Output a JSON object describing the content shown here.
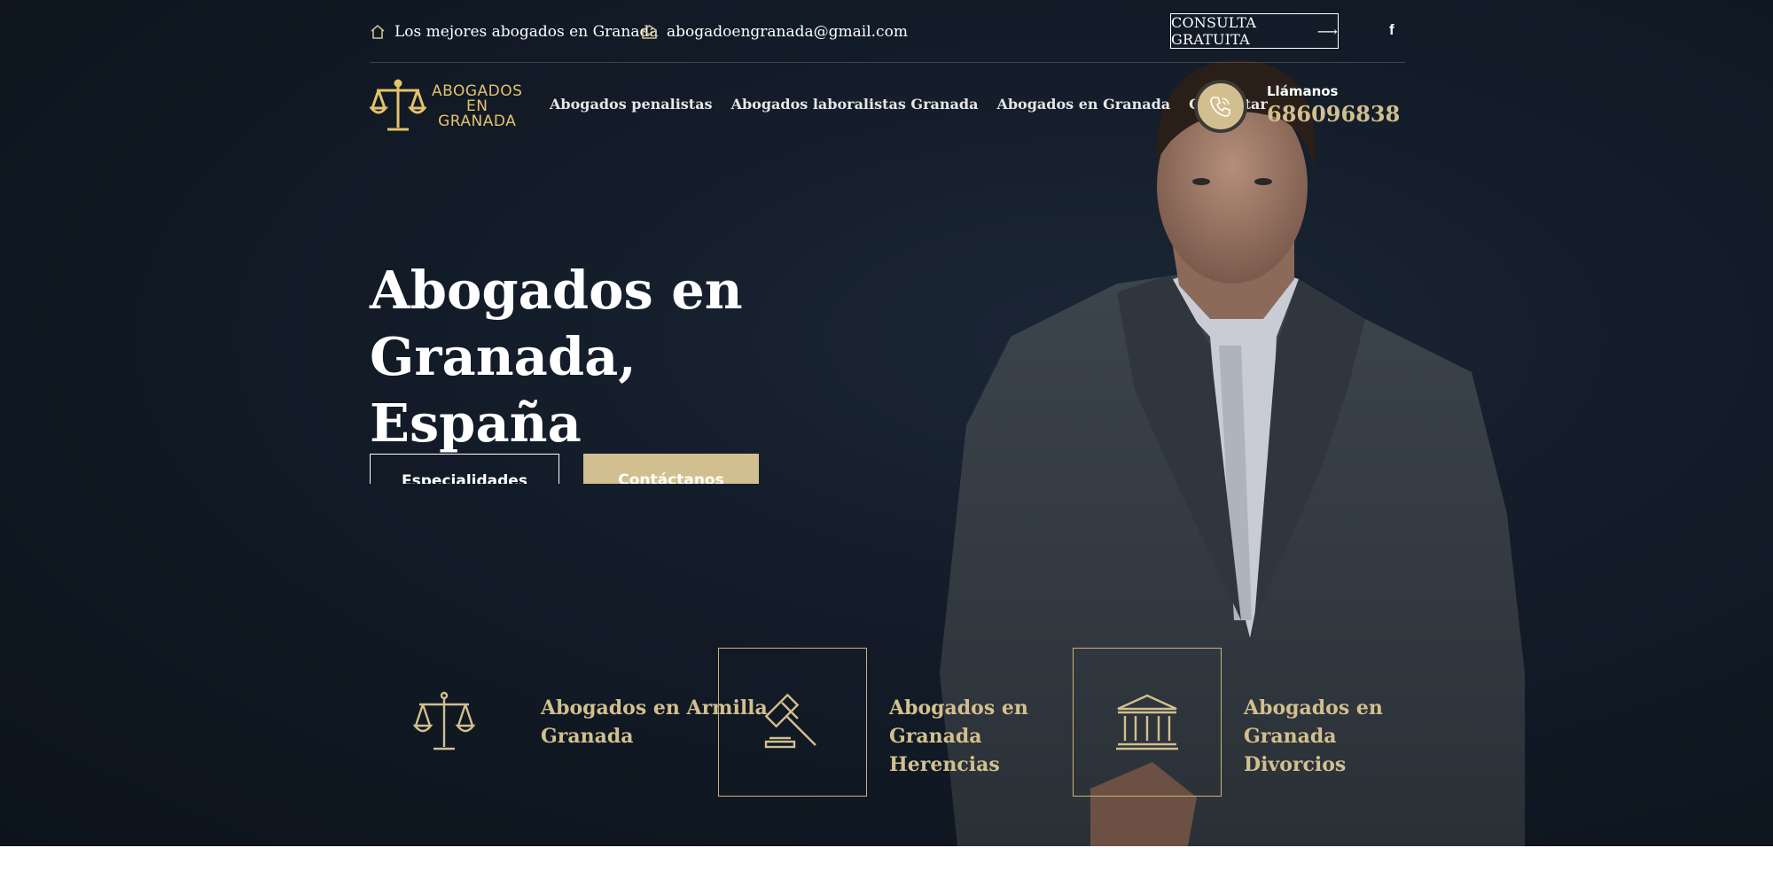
{
  "topbar": {
    "tagline": "Los mejores abogados en Granada",
    "email": "abogadoengranada@gmail.com",
    "consult_label": "CONSULTA GRATUITA",
    "facebook_glyph": "f"
  },
  "logo": {
    "line1": "ABOGADOS",
    "line2": "EN",
    "line3": "GRANADA"
  },
  "nav": {
    "items": [
      {
        "label": "Abogados penalistas"
      },
      {
        "label": "Abogados laboralistas Granada"
      },
      {
        "label": "Abogados en Granada"
      },
      {
        "label": "Contactar"
      }
    ]
  },
  "call": {
    "label": "Llámanos",
    "number": "686096838"
  },
  "hero": {
    "title_line1": "Abogados en Granada,",
    "title_line2": "España",
    "button_primary": "Especialidades",
    "button_secondary": "Contáctanos"
  },
  "services": [
    {
      "line1": "Abogados en Armilla",
      "line2": "Granada",
      "icon": "scales-icon"
    },
    {
      "line1": "Abogados en Granada",
      "line2": "Herencias",
      "icon": "gavel-icon"
    },
    {
      "line1": "Abogados en Granada",
      "line2": "Divorcios",
      "icon": "courthouse-icon"
    }
  ],
  "colors": {
    "accent": "#d2bf8f",
    "logo_gold": "#e2c36a",
    "background_dark": "#121b27"
  }
}
